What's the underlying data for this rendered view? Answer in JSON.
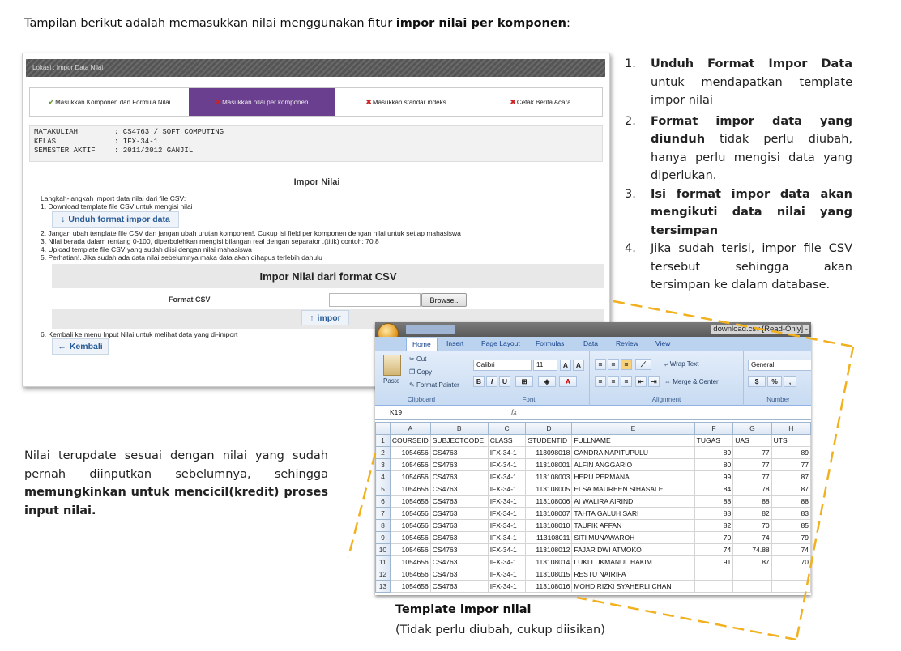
{
  "intro": {
    "text_before": "Tampilan berikut adalah memasukkan nilai menggunakan fitur ",
    "bold": "impor nilai per komponen",
    "text_after": ":"
  },
  "app": {
    "location": "Lokasi : Impor Data Nilai",
    "steps": [
      {
        "label": "Masukkan Komponen dan Formula Nilai",
        "mark": "✔"
      },
      {
        "label": "Masukkan nilai per komponen",
        "mark": "✖"
      },
      {
        "label": "Masukkan standar indeks",
        "mark": "✖"
      },
      {
        "label": "Cetak Berita Acara",
        "mark": "✖"
      }
    ],
    "info": [
      {
        "key": "MATAKULIAH",
        "value": ": CS4763 / SOFT COMPUTING"
      },
      {
        "key": "KELAS",
        "value": ": IFX-34-1"
      },
      {
        "key": "SEMESTER AKTIF",
        "value": ": 2011/2012 GANJIL"
      }
    ],
    "impor_title": "Impor Nilai",
    "instructions_intro": "Langkah-langkah import data nilai dari file CSV:",
    "instruction_1": "1.  Download template file CSV untuk mengisi nilai",
    "download_button": "Unduh format impor data",
    "instructions": [
      "2.  Jangan ubah template file CSV dan jangan ubah urutan komponen!. Cukup isi field per komponen dengan nilai untuk setiap mahasiswa",
      "3.  Nilai berada dalam rentang 0-100, diperbolehkan mengisi bilangan real dengan separator .(titik) contoh: 70.8",
      "4.  Upload template file CSV yang sudah diisi dengan nilai mahasiswa",
      "5.  Perhatian!. Jika sudah ada data nilai sebelumnya maka data akan dihapus terlebih dahulu"
    ],
    "csv_header": "Impor Nilai dari format CSV",
    "format_label": "Format CSV",
    "browse_button": "Browse..",
    "impor_button": "impor",
    "instruction_6": "6.  Kembali ke menu Input Nilai untuk melihat data yang di-import",
    "back_button": "Kembali"
  },
  "list": [
    {
      "num": "1.",
      "bold": "Unduh Format Impor Data",
      "text": " untuk mendapatkan template impor nilai"
    },
    {
      "num": "2.",
      "bold": "Format impor data yang diunduh",
      "text": " tidak perlu diubah, hanya perlu mengisi data yang diperlukan."
    },
    {
      "num": "3.",
      "bold": "Isi format impor data akan mengikuti data nilai yang tersimpan",
      "text": ""
    },
    {
      "num": "4.",
      "bold": "",
      "text": "Jika sudah terisi, impor file CSV tersebut sehingga akan tersimpan ke dalam database."
    }
  ],
  "note": {
    "text": "Nilai terupdate sesuai dengan nilai yang sudah pernah diinputkan sebelumnya, sehingga ",
    "bold": "memungkinkan untuk mencicil(kredit) proses input nilai."
  },
  "caption": {
    "title": "Template impor nilai",
    "sub": "(Tidak perlu diubah, cukup diisikan)"
  },
  "excel": {
    "filename": "download.csv  [Read-Only] -",
    "tabs": [
      "Home",
      "Insert",
      "Page Layout",
      "Formulas",
      "Data",
      "Review",
      "View"
    ],
    "clipboard": {
      "paste": "Paste",
      "cut": "Cut",
      "copy": "Copy",
      "format_painter": "Format Painter",
      "label": "Clipboard"
    },
    "font": {
      "name": "Calibri",
      "size": "11",
      "label": "Font"
    },
    "alignment": {
      "wrap": "Wrap Text",
      "merge": "Merge & Center",
      "label": "Alignment"
    },
    "number": {
      "format": "General",
      "label": "Number"
    },
    "name_box": "K19",
    "fx": "fx",
    "col_letters": [
      "A",
      "B",
      "C",
      "D",
      "E",
      "F",
      "G",
      "H"
    ],
    "headers": [
      "COURSEID",
      "SUBJECTCODE",
      "CLASS",
      "STUDENTID",
      "FULLNAME",
      "TUGAS",
      "UAS",
      "UTS"
    ],
    "rows": [
      [
        "1054656",
        "CS4763",
        "IFX-34-1",
        "113098018",
        "CANDRA NAPITUPULU",
        "89",
        "77",
        "89"
      ],
      [
        "1054656",
        "CS4763",
        "IFX-34-1",
        "113108001",
        "ALFIN ANGGARIO",
        "80",
        "77",
        "77"
      ],
      [
        "1054656",
        "CS4763",
        "IFX-34-1",
        "113108003",
        "HERU PERMANA",
        "99",
        "77",
        "87"
      ],
      [
        "1054656",
        "CS4763",
        "IFX-34-1",
        "113108005",
        "ELSA MAUREEN SIHASALE",
        "84",
        "78",
        "87"
      ],
      [
        "1054656",
        "CS4763",
        "IFX-34-1",
        "113108006",
        "AI WALIRA AIRIND",
        "88",
        "88",
        "88"
      ],
      [
        "1054656",
        "CS4763",
        "IFX-34-1",
        "113108007",
        "TAHTA GALUH SARI",
        "88",
        "82",
        "83"
      ],
      [
        "1054656",
        "CS4763",
        "IFX-34-1",
        "113108010",
        "TAUFIK AFFAN",
        "82",
        "70",
        "85"
      ],
      [
        "1054656",
        "CS4763",
        "IFX-34-1",
        "113108011",
        "SITI MUNAWAROH",
        "70",
        "74",
        "79"
      ],
      [
        "1054656",
        "CS4763",
        "IFX-34-1",
        "113108012",
        "FAJAR DWI ATMOKO",
        "74",
        "74.88",
        "74"
      ],
      [
        "1054656",
        "CS4763",
        "IFX-34-1",
        "113108014",
        "LUKI LUKMANUL HAKIM",
        "91",
        "87",
        "70"
      ],
      [
        "1054656",
        "CS4763",
        "IFX-34-1",
        "113108015",
        "RESTU NAIRIFA",
        "",
        "",
        ""
      ],
      [
        "1054656",
        "CS4763",
        "IFX-34-1",
        "113108016",
        "MOHD RIZKI SYAHERLI CHAN",
        "",
        "",
        ""
      ]
    ]
  }
}
